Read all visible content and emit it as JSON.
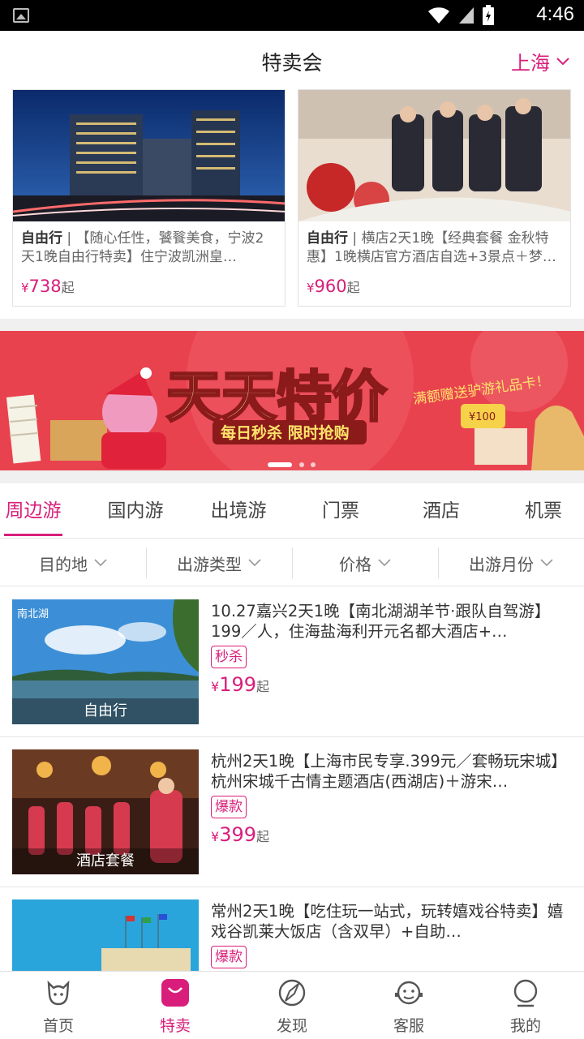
{
  "status_bar": {
    "time": "4:46"
  },
  "header": {
    "title": "特卖会",
    "city": "上海"
  },
  "featured": [
    {
      "type": "自由行",
      "desc": "【随心任性，饕餮美食，宁波2天1晚自由行特卖】住宁波凯洲皇…",
      "price_symbol": "¥",
      "price": "738",
      "suffix": "起"
    },
    {
      "type": "自由行",
      "desc": "横店2天1晚【经典套餐 金秋特惠】1晚横店官方酒店自选+3景点＋梦…",
      "price_symbol": "¥",
      "price": "960",
      "suffix": "起"
    }
  ],
  "banner": {
    "headline": "天天特价",
    "subline": "每日秒杀 限时抢购",
    "promo": "满额赠送驴游礼品卡！",
    "card_value": "¥100"
  },
  "tabs": [
    "周边游",
    "国内游",
    "出境游",
    "门票",
    "酒店",
    "机票"
  ],
  "filters": [
    "目的地",
    "出游类型",
    "价格",
    "出游月份"
  ],
  "items": [
    {
      "title": "10.27嘉兴2天1晚【南北湖湖羊节·跟队自驾游】199／人，住海盐海利开元名都大酒店+…",
      "tag": "自由行",
      "badge": "秒杀",
      "price_symbol": "¥",
      "price": "199",
      "suffix": "起",
      "thumb_text": "南北湖"
    },
    {
      "title": "杭州2天1晚【上海市民专享.399元／套畅玩宋城】杭州宋城千古情主题酒店(西湖店)＋游宋…",
      "tag": "酒店套餐",
      "badge": "爆款",
      "price_symbol": "¥",
      "price": "399",
      "suffix": "起"
    },
    {
      "title": "常州2天1晚【吃住玩一站式，玩转嬉戏谷特卖】嬉戏谷凯莱大饭店（含双早）+自助…",
      "tag": "",
      "badge": "爆款",
      "price_symbol": "¥",
      "price": "",
      "suffix": ""
    }
  ],
  "bottom_nav": [
    {
      "label": "首页",
      "icon": "home-icon"
    },
    {
      "label": "特卖",
      "icon": "bag-icon"
    },
    {
      "label": "发现",
      "icon": "discover-icon"
    },
    {
      "label": "客服",
      "icon": "service-icon"
    },
    {
      "label": "我的",
      "icon": "profile-icon"
    }
  ],
  "colors": {
    "accent": "#d81e7a"
  }
}
